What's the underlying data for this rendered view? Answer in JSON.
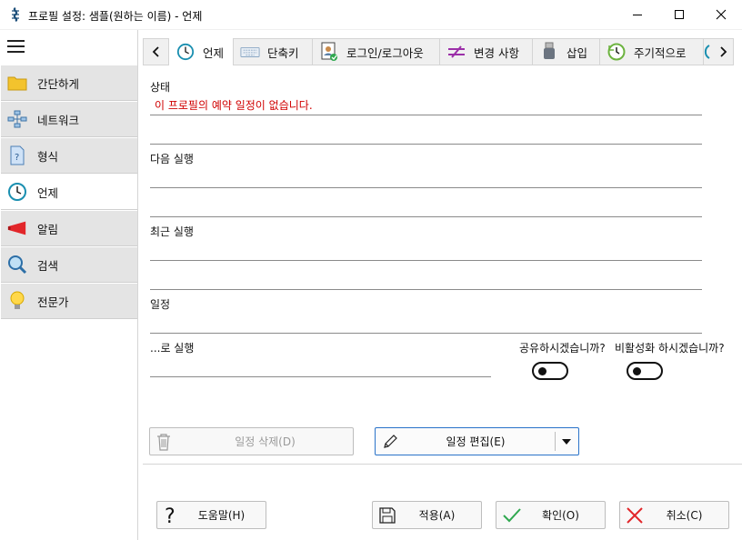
{
  "window": {
    "title": "프로필 설정: 샘플(원하는 이름) - 언제"
  },
  "sidebar": {
    "items": [
      {
        "label": "간단하게",
        "icon": "folder-icon"
      },
      {
        "label": "네트워크",
        "icon": "network-icon"
      },
      {
        "label": "형식",
        "icon": "document-question-icon"
      },
      {
        "label": "언제",
        "icon": "clock-icon"
      },
      {
        "label": "알림",
        "icon": "megaphone-icon"
      },
      {
        "label": "검색",
        "icon": "magnifier-icon"
      },
      {
        "label": "전문가",
        "icon": "lightbulb-icon"
      }
    ],
    "active": "언제"
  },
  "tabs": {
    "items": [
      {
        "label": "언제",
        "icon": "clock-icon"
      },
      {
        "label": "단축키",
        "icon": "keyboard-icon"
      },
      {
        "label": "로그인/로그아웃",
        "icon": "user-badge-icon"
      },
      {
        "label": "변경 사항",
        "icon": "change-icon"
      },
      {
        "label": "삽입",
        "icon": "usb-icon"
      },
      {
        "label": "주기적으로",
        "icon": "cycle-clock-icon"
      }
    ],
    "active": "언제"
  },
  "main": {
    "status_label": "상태",
    "status_value": "이 프로필의 예약 일정이 없습니다.",
    "next_run_label": "다음 실행",
    "last_run_label": "최근 실행",
    "schedule_label": "일정",
    "run_as_label": "...로 실행",
    "share_label": "공유하시겠습니까?",
    "disable_label": "비활성화 하시겠습니까?",
    "delete_schedule": "일정 삭제(D)",
    "edit_schedule": "일정 편집(E)"
  },
  "footer": {
    "help": "도움말(H)",
    "apply": "적용(A)",
    "ok": "확인(O)",
    "cancel": "취소(C)"
  },
  "colors": {
    "status_error": "#d00000",
    "accent_border": "#2a73c9",
    "active_tab_clock": "#1a8fb0"
  }
}
